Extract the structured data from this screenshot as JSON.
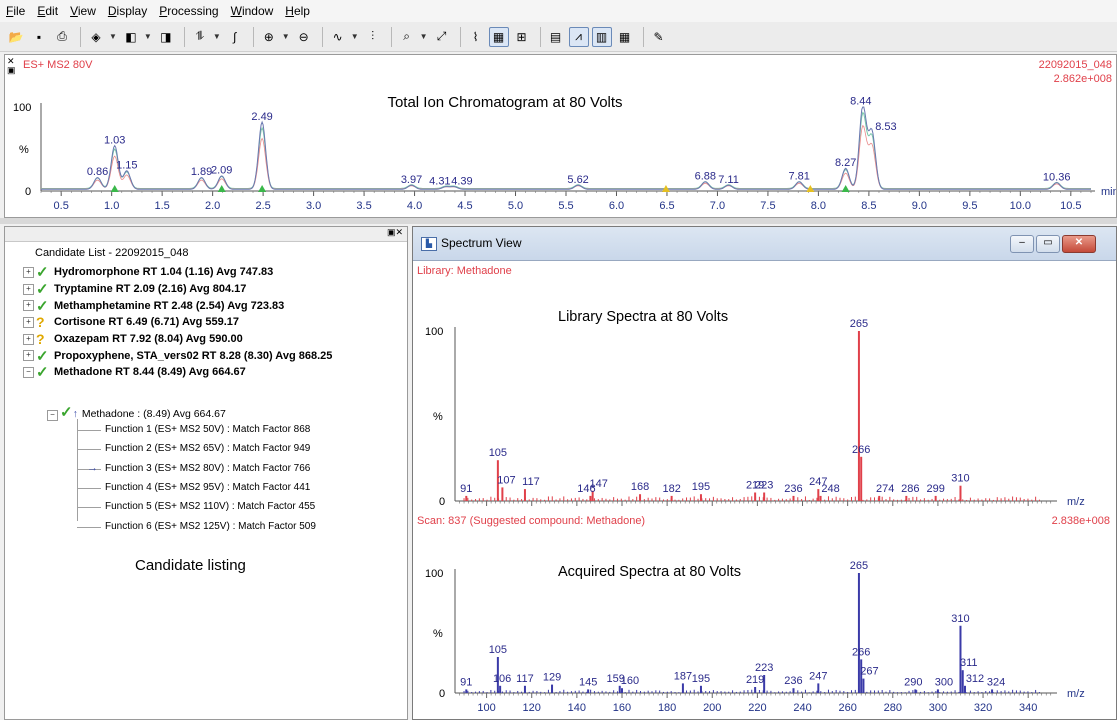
{
  "menu": [
    "File",
    "Edit",
    "View",
    "Display",
    "Processing",
    "Window",
    "Help"
  ],
  "toolbar_icons": [
    "open-icon",
    "save-icon",
    "print-icon",
    "spectrum-tool-icon",
    "copy-icon",
    "paste-icon",
    "peak-detect-icon",
    "integrate-icon",
    "combine-icon",
    "subtract-icon",
    "smooth-icon",
    "centroid-icon",
    "library-search-icon",
    "fit-icon",
    "chromatogram-icon",
    "spectrum-icon",
    "map-icon",
    "report-icon",
    "overlay-icon",
    "stack-icon",
    "grid-icon",
    "edit-icon"
  ],
  "tic": {
    "header_left": "ES+ MS2 80V",
    "file_id": "22092015_048",
    "intensity": "2.862e+008",
    "title": "Total Ion Chromatogram at 80 Volts",
    "y_labels": [
      "100",
      "%",
      "0"
    ],
    "x_unit": "min",
    "x_ticks": [
      "0.5",
      "1.0",
      "1.5",
      "2.0",
      "2.5",
      "3.0",
      "3.5",
      "4.0",
      "4.5",
      "5.0",
      "5.5",
      "6.0",
      "6.5",
      "7.0",
      "7.5",
      "8.0",
      "8.5",
      "9.0",
      "9.5",
      "10.0",
      "10.5"
    ],
    "peak_labels": [
      "0.86",
      "1.03",
      "1.15",
      "1.89",
      "2.09",
      "2.49",
      "3.97",
      "4.31",
      "4.39",
      "5.62",
      "6.88",
      "7.11",
      "7.81",
      "8.27",
      "8.44",
      "8.53",
      "10.36"
    ]
  },
  "candidates": {
    "root": "Candidate List - 22092015_048",
    "items": [
      {
        "label": "Hydromorphone RT 1.04 (1.16) Avg 747.83",
        "status": "check"
      },
      {
        "label": "Tryptamine RT 2.09 (2.16) Avg 804.17",
        "status": "check"
      },
      {
        "label": "Methamphetamine RT 2.48 (2.54) Avg 723.83",
        "status": "check"
      },
      {
        "label": "Cortisone RT 6.49 (6.71) Avg 559.17",
        "status": "question"
      },
      {
        "label": "Oxazepam RT 7.92 (8.04) Avg 590.00",
        "status": "question"
      },
      {
        "label": "Propoxyphene, STA_vers02 RT 8.28 (8.30) Avg 868.25",
        "status": "check"
      },
      {
        "label": "Methadone RT 8.44 (8.49) Avg 664.67",
        "status": "check"
      }
    ],
    "sub_item": "Methadone : (8.49) Avg 664.67",
    "functions": [
      "Function 1 (ES+ MS2  50V) : Match Factor 868",
      "Function 2 (ES+ MS2  65V) : Match Factor 949",
      "Function 3 (ES+ MS2  80V) : Match Factor 766",
      "Function 4 (ES+ MS2  95V) : Match Factor 441",
      "Function 5 (ES+ MS2 110V) : Match Factor 455",
      "Function 6 (ES+ MS2 125V) : Match Factor 509"
    ],
    "caption": "Candidate listing"
  },
  "spectrum": {
    "window_title": "Spectrum View",
    "library_header": "Library: Methadone",
    "library_title": "Library Spectra at 80 Volts",
    "scan_header": "Scan: 837 (Suggested compound: Methadone)",
    "scan_intensity": "2.838e+008",
    "acquired_title": "Acquired Spectra at 80 Volts",
    "y_labels": [
      "100",
      "%",
      "0"
    ],
    "x_unit": "m/z",
    "x_ticks": [
      "100",
      "120",
      "140",
      "160",
      "180",
      "200",
      "220",
      "240",
      "260",
      "280",
      "300",
      "320",
      "340"
    ]
  },
  "colors": {
    "library": "#e0404a",
    "acquired": "#3a3aa8",
    "check": "#3aa52e",
    "question": "#e0a800"
  },
  "chart_data": [
    {
      "type": "line",
      "title": "Total Ion Chromatogram at 80 Volts",
      "xlabel": "min",
      "ylabel": "%",
      "xlim": [
        0.3,
        10.7
      ],
      "ylim": [
        0,
        100
      ],
      "series": [
        {
          "x": [
            0.86,
            1.03,
            1.15,
            1.89,
            2.09,
            2.49,
            3.97,
            4.31,
            4.39,
            5.62,
            6.88,
            7.11,
            7.81,
            8.27,
            8.44,
            8.53,
            10.36
          ],
          "values": [
            14,
            52,
            22,
            14,
            16,
            80,
            5,
            3,
            3,
            5,
            9,
            5,
            9,
            25,
            98,
            68,
            8
          ]
        }
      ]
    },
    {
      "type": "bar",
      "title": "Library Spectra at 80 Volts",
      "xlabel": "m/z",
      "ylabel": "%",
      "xlim": [
        86,
        351
      ],
      "ylim": [
        0,
        100
      ],
      "series": [
        {
          "name": "Library: Methadone",
          "x": [
            91,
            105,
            107,
            117,
            146,
            147,
            168,
            182,
            195,
            219,
            223,
            236,
            247,
            248,
            265,
            266,
            274,
            286,
            299,
            310
          ],
          "values": [
            3,
            24,
            8,
            7,
            3,
            6,
            4,
            3,
            4,
            5,
            5,
            3,
            7,
            3,
            100,
            26,
            3,
            3,
            3,
            9
          ]
        }
      ]
    },
    {
      "type": "bar",
      "title": "Acquired Spectra at 80 Volts",
      "xlabel": "m/z",
      "ylabel": "%",
      "xlim": [
        86,
        351
      ],
      "ylim": [
        0,
        100
      ],
      "series": [
        {
          "name": "Scan: 837 (Suggested compound: Methadone)",
          "x": [
            91,
            105,
            106,
            117,
            129,
            145,
            159,
            160,
            187,
            195,
            219,
            223,
            236,
            247,
            265,
            266,
            267,
            290,
            300,
            310,
            311,
            312,
            324
          ],
          "values": [
            3,
            30,
            6,
            6,
            7,
            3,
            6,
            4,
            8,
            6,
            5,
            15,
            4,
            8,
            100,
            28,
            12,
            3,
            3,
            56,
            19,
            6,
            3
          ]
        }
      ]
    }
  ]
}
